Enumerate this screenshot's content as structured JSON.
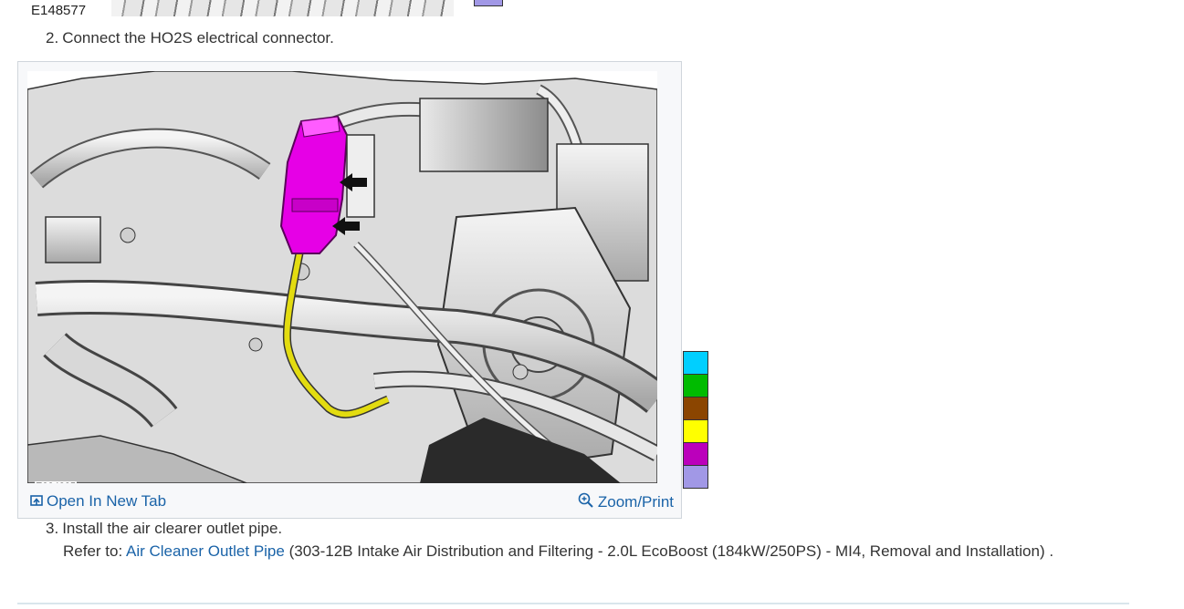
{
  "previous_figure": {
    "id": "E148577"
  },
  "steps": [
    {
      "number": "2.",
      "text": "Connect the HO2S electrical connector."
    },
    {
      "number": "3.",
      "text": "Install the air clearer outlet pipe."
    }
  ],
  "figure": {
    "id": "E234325",
    "open_tab_label": "Open In New Tab",
    "zoom_label": "Zoom/Print",
    "icons": {
      "open": "open-new-tab-icon",
      "zoom": "magnifier-zoom-icon"
    }
  },
  "refer": {
    "prefix": "Refer to: ",
    "link_text": "Air Cleaner Outlet Pipe",
    "suffix": " (303-12B Intake Air Distribution and Filtering - 2.0L EcoBoost (184kW/250PS) - MI4, Removal and Installation) ."
  },
  "color_legend": [
    "#00cfff",
    "#00bb00",
    "#8b4500",
    "#ffff00",
    "#bb00bb",
    "#a198e6"
  ],
  "colors": {
    "link": "#1a63a8",
    "text": "#333333",
    "component_highlight": "#e600e6",
    "harness_highlight": "#d6cf00"
  }
}
